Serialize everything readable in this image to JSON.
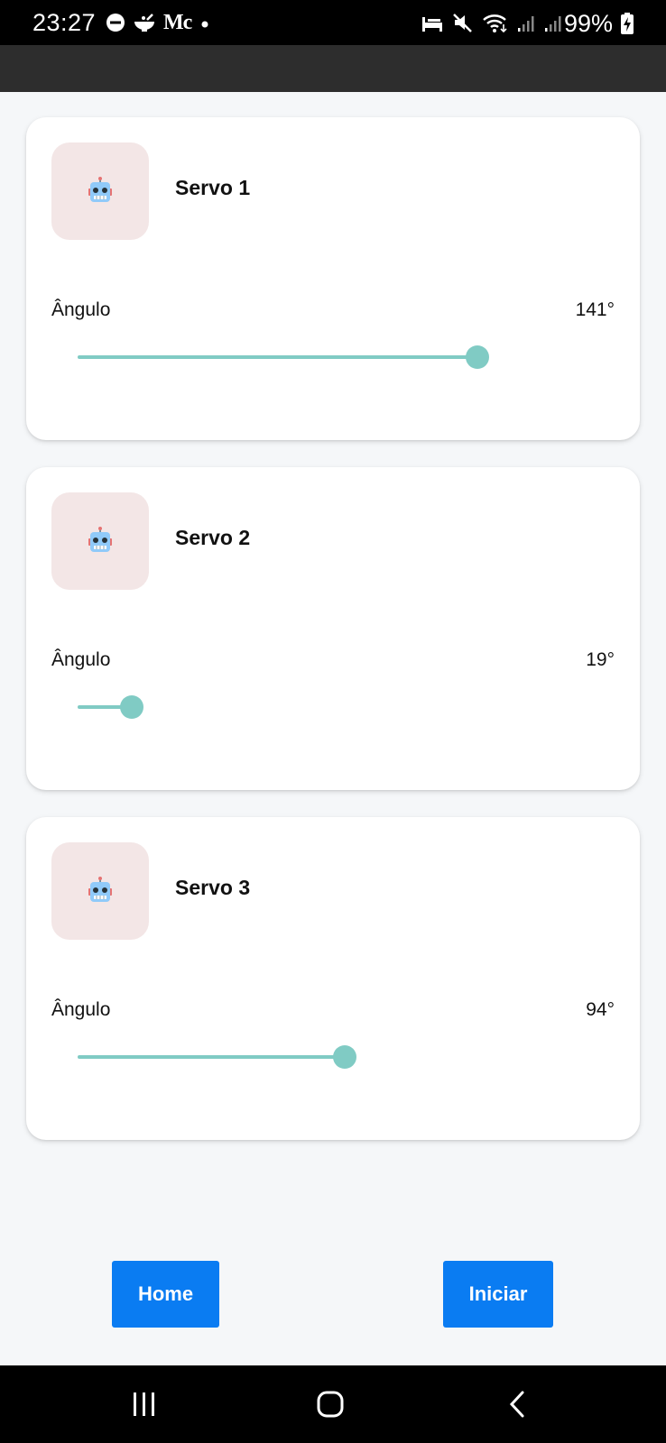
{
  "status_bar": {
    "time": "23:27",
    "app_text": "Mc",
    "battery": "99%"
  },
  "servos": [
    {
      "name": "Servo 1",
      "angle_label": "Ângulo",
      "angle_value": "141°",
      "angle": 141,
      "max_angle": 180,
      "icon": "robot-icon"
    },
    {
      "name": "Servo 2",
      "angle_label": "Ângulo",
      "angle_value": "19°",
      "angle": 19,
      "max_angle": 180,
      "icon": "robot-icon"
    },
    {
      "name": "Servo 3",
      "angle_label": "Ângulo",
      "angle_value": "94°",
      "angle": 94,
      "max_angle": 180,
      "icon": "robot-icon"
    }
  ],
  "buttons": {
    "home": "Home",
    "start": "Iniciar"
  },
  "colors": {
    "accent": "#0a7cf2",
    "slider": "#80cbc4",
    "avatar_bg": "#f3e6e6",
    "app_bar": "#2d2d2d",
    "background": "#f5f7f9"
  },
  "nav_bar": {
    "icons": [
      "recent-apps-icon",
      "home-circle-icon",
      "back-icon"
    ]
  }
}
